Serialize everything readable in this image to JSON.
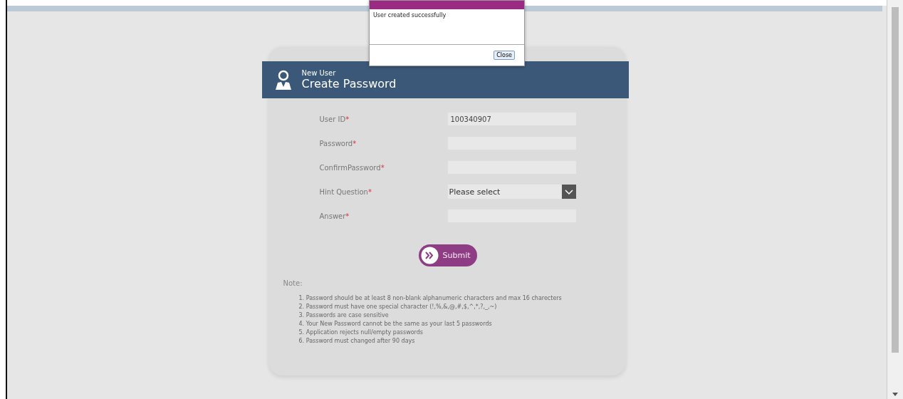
{
  "dialog": {
    "message": "User created successfully",
    "button": "Close"
  },
  "form": {
    "subtitle": "New User",
    "title": "Create Password",
    "fields": [
      {
        "label": "User ID",
        "kind": "text",
        "value": "100340907"
      },
      {
        "label": "Password",
        "kind": "text"
      },
      {
        "label": "ConfirmPassword",
        "kind": "text"
      },
      {
        "label": "Hint Question",
        "kind": "select",
        "value": "Please select"
      },
      {
        "label": "Answer",
        "kind": "text"
      }
    ],
    "required_mark": "*",
    "submit": "Submit",
    "note_title": "Note:",
    "notes": [
      "1. Password should be at least 8 non-blank alphanumeric characters and max 16 charecters",
      "2. Password must have one special character (!,%,&,@,#,$,^,*,?,_,~)",
      "3. Passwords are case sensitive",
      "4. Your New Password cannot be the same as your last 5 passwords",
      "5. Application rejects null/empty passwords",
      "6. Password must changed after 90 days"
    ]
  }
}
